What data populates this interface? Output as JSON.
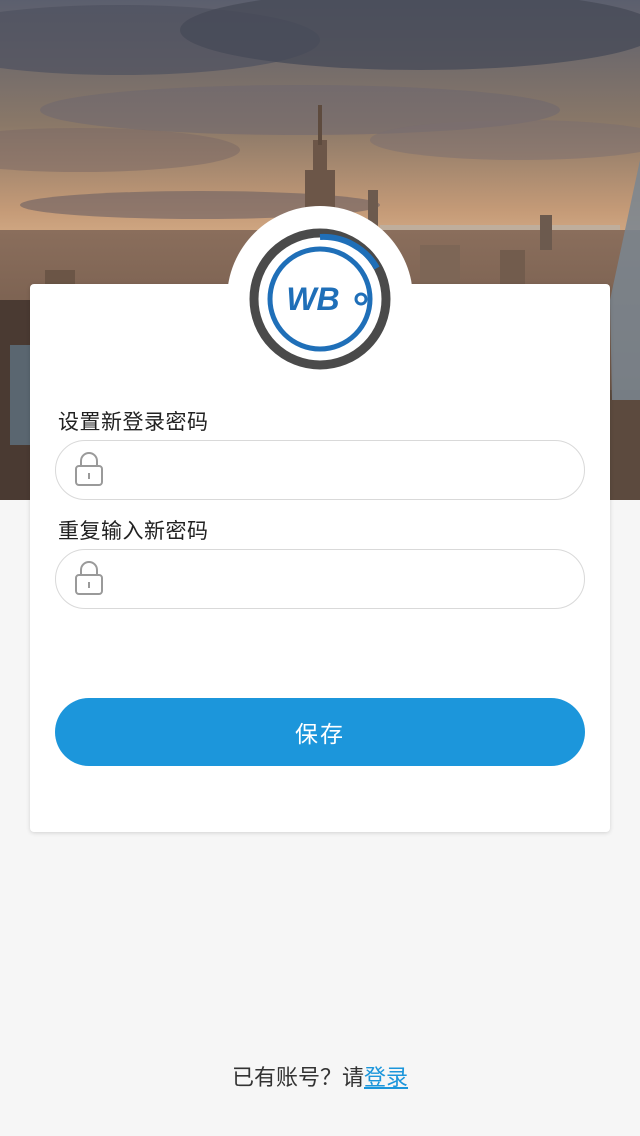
{
  "logo": {
    "text": "WB",
    "colors": {
      "ring": "#4a4a4a",
      "inner_ring": "#1f6fb8",
      "letters": "#1f6fb8"
    }
  },
  "form": {
    "new_password_label": "设置新登录密码",
    "repeat_password_label": "重复输入新密码",
    "new_password_value": "",
    "repeat_password_value": "",
    "lock_icon": "lock-icon"
  },
  "save_button": {
    "label": "保存",
    "color": "#1c96db"
  },
  "footer": {
    "prompt": "已有账号？请",
    "login_link": "登录"
  }
}
